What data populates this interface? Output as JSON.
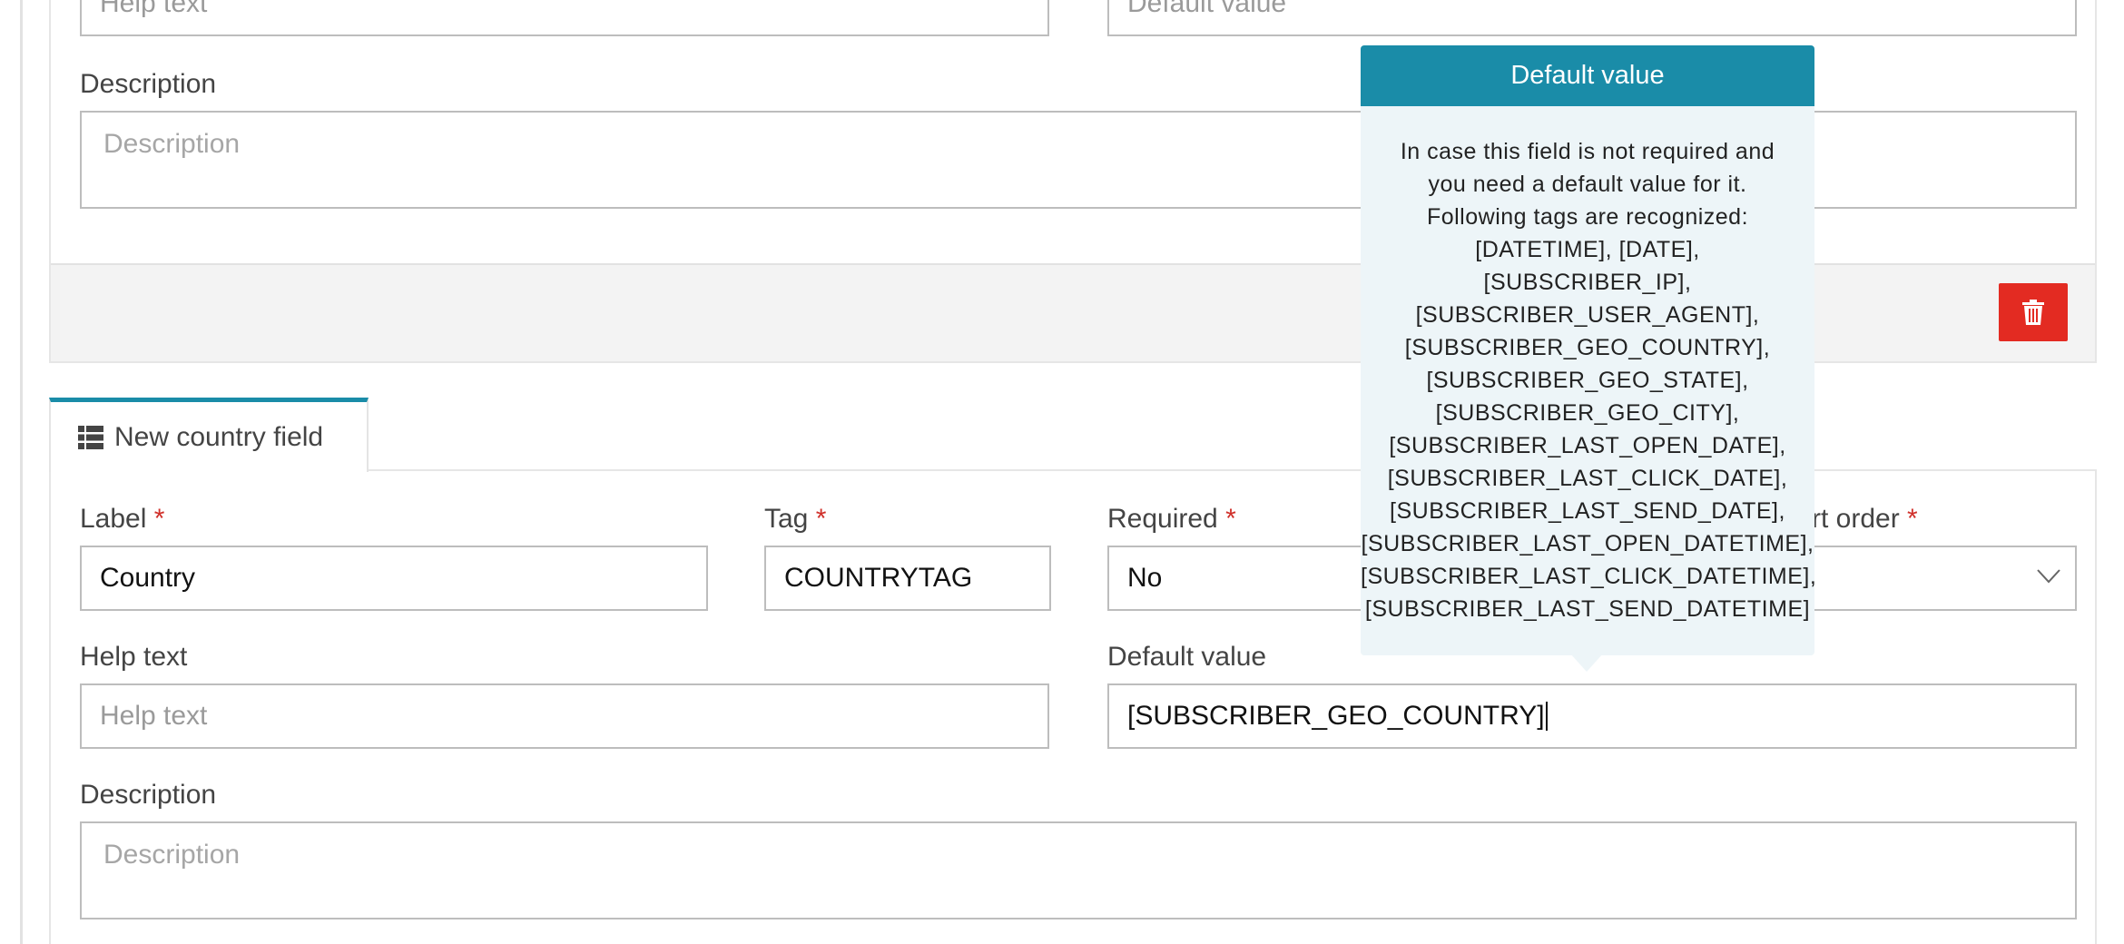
{
  "top_section": {
    "help_text_placeholder": "Help text",
    "default_value_placeholder": "Default value",
    "description_label": "Description",
    "description_placeholder": "Description"
  },
  "tooltip": {
    "title": "Default value",
    "lines": [
      "In case this field is not required and",
      "you need a default value for it.",
      "Following tags are recognized:",
      "[DATETIME], [DATE],",
      "[SUBSCRIBER_IP],",
      "[SUBSCRIBER_USER_AGENT],",
      "[SUBSCRIBER_GEO_COUNTRY],",
      "[SUBSCRIBER_GEO_STATE],",
      "[SUBSCRIBER_GEO_CITY],",
      "[SUBSCRIBER_LAST_OPEN_DATE],",
      "[SUBSCRIBER_LAST_CLICK_DATE],",
      "[SUBSCRIBER_LAST_SEND_DATE],",
      "[SUBSCRIBER_LAST_OPEN_DATETIME],",
      "[SUBSCRIBER_LAST_CLICK_DATETIME],",
      "[SUBSCRIBER_LAST_SEND_DATETIME]"
    ]
  },
  "new_field": {
    "tab_label": "New country field",
    "tab_icon": "list-icon",
    "label_label": "Label",
    "label_value": "Country",
    "tag_label": "Tag",
    "tag_value": "COUNTRYTAG",
    "required_label": "Required",
    "required_value": "No",
    "sort_order_label": "rt order",
    "help_text_label": "Help text",
    "help_text_placeholder": "Help text",
    "default_value_label": "Default value",
    "default_value_value": "[SUBSCRIBER_GEO_COUNTRY]",
    "description_label": "Description",
    "description_placeholder": "Description",
    "required_marker": "*"
  },
  "colors": {
    "accent": "#1a8ca8",
    "danger": "#e32b22",
    "tooltip_bg": "#edf5f8"
  }
}
